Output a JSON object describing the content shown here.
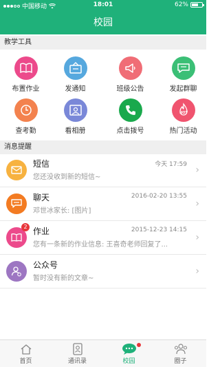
{
  "status_bar": {
    "carrier": "中国移动",
    "time": "18:01",
    "battery": "62%",
    "battery_level": 0.62
  },
  "nav": {
    "title": "校园"
  },
  "teaching_tools": {
    "header": "教学工具",
    "items": [
      {
        "label": "布置作业",
        "icon": "book-icon",
        "color": "#ec4a8b"
      },
      {
        "label": "发通知",
        "icon": "notice-board-icon",
        "color": "#56a8de"
      },
      {
        "label": "班级公告",
        "icon": "megaphone-icon",
        "color": "#f06d76"
      },
      {
        "label": "发起群聊",
        "icon": "chat-bubble-icon",
        "color": "#3bbf76"
      },
      {
        "label": "查考勤",
        "icon": "clock-icon",
        "color": "#f3824e"
      },
      {
        "label": "看相册",
        "icon": "album-icon",
        "color": "#7a88d8"
      },
      {
        "label": "点击拨号",
        "icon": "phone-icon",
        "color": "#1aa94d"
      },
      {
        "label": "热门活动",
        "icon": "hot-icon",
        "color": "#f0546f"
      }
    ]
  },
  "messages": {
    "header": "消息提醒",
    "items": [
      {
        "title": "短信",
        "time": "今天 17:59",
        "preview": "您还没收到新的短信~",
        "icon": "envelope-icon",
        "color": "#f7b240",
        "badge": ""
      },
      {
        "title": "聊天",
        "time": "2016-02-20 13:55",
        "preview": "邓世冰家长: [图片]",
        "icon": "chat-icon",
        "color": "#f37b22",
        "badge": ""
      },
      {
        "title": "作业",
        "time": "2015-12-23 14:15",
        "preview": "您有一条新的作业信息: 王喜奇老师回复了...",
        "icon": "book-icon",
        "color": "#ec4a8b",
        "badge": "2"
      },
      {
        "title": "公众号",
        "time": "",
        "preview": "暂时没有新的文章~",
        "icon": "person-icon",
        "color": "#9d76c2",
        "badge": ""
      }
    ]
  },
  "tab_bar": {
    "items": [
      {
        "label": "首页",
        "icon": "home-icon"
      },
      {
        "label": "通讯录",
        "icon": "contacts-icon"
      },
      {
        "label": "校园",
        "icon": "campus-chat-icon"
      },
      {
        "label": "圈子",
        "icon": "group-icon"
      }
    ],
    "active_index": 2
  }
}
